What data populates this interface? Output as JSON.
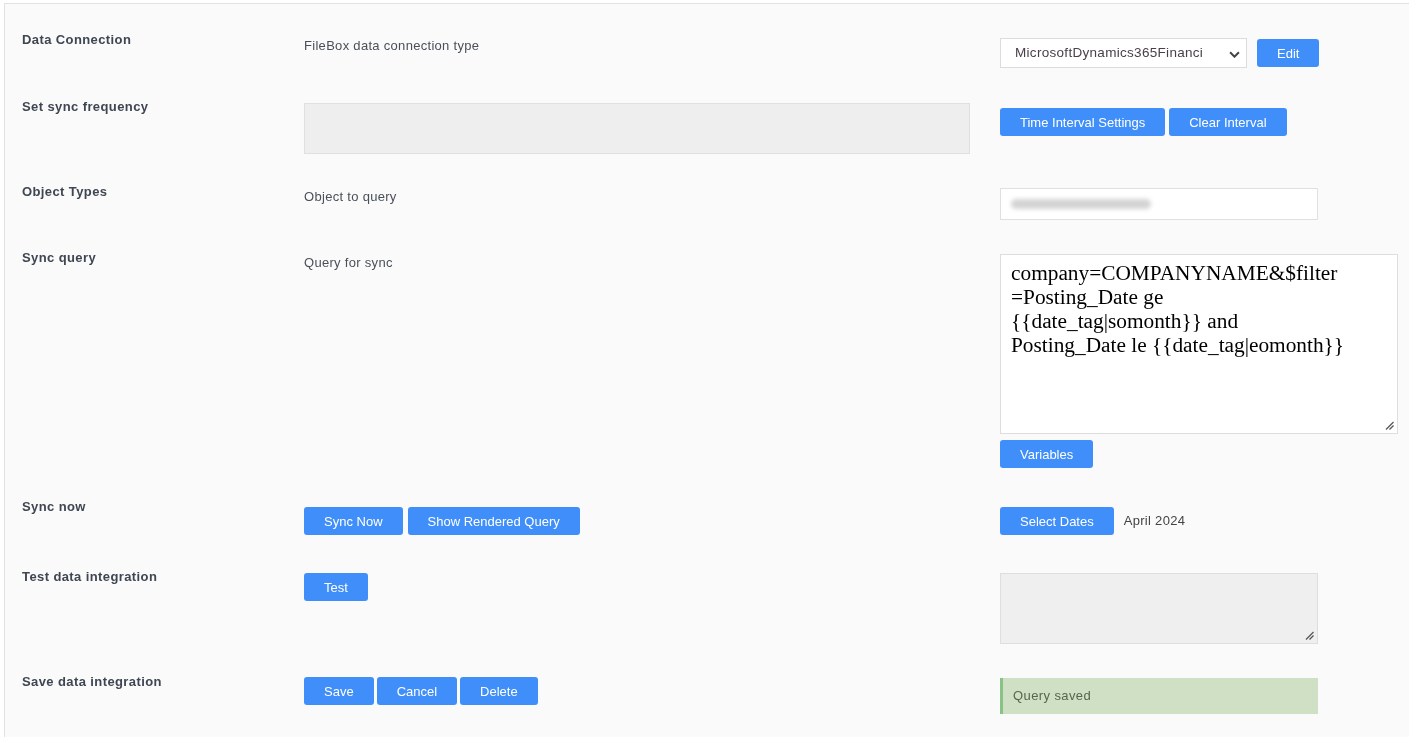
{
  "rows": [
    {
      "label": "Data Connection",
      "middle": [
        {
          "kind": "text",
          "text": "FileBox data connection type"
        }
      ],
      "right": [
        {
          "kind": "select",
          "value": "MicrosoftDynamics365Financi"
        },
        {
          "kind": "button",
          "label": "Edit"
        }
      ]
    },
    {
      "label": "Set sync frequency",
      "middle": [
        {
          "kind": "input",
          "disabled": true
        }
      ],
      "right": [
        {
          "kind": "button",
          "label": "Time Interval Settings"
        },
        {
          "kind": "button",
          "label": "Clear Interval"
        }
      ]
    },
    {
      "label": "Object Types",
      "middle": [
        {
          "kind": "text",
          "text": "Object to query"
        }
      ],
      "right": [
        {
          "kind": "input",
          "disabled": false,
          "blurred": true
        }
      ]
    },
    {
      "label": "Sync query",
      "middle": [
        {
          "kind": "text",
          "text": "Query for sync"
        }
      ],
      "right": [
        {
          "kind": "textarea",
          "disabled": false,
          "value": "company=COMPANYNAME&$filter=Posting_Date ge {{date_tag|somonth}} and Posting_Date le {{date_tag|eomonth}}"
        },
        {
          "kind": "button",
          "label": "Variables"
        }
      ]
    },
    {
      "label": "Sync now",
      "middle": [
        {
          "kind": "button",
          "label": "Sync Now"
        },
        {
          "kind": "button",
          "label": "Show Rendered Query"
        }
      ],
      "right": [
        {
          "kind": "button",
          "label": "Select Dates"
        },
        {
          "kind": "text",
          "text": "April 2024"
        }
      ]
    },
    {
      "label": "Test data integration",
      "middle": [
        {
          "kind": "button",
          "label": "Test"
        }
      ],
      "right": [
        {
          "kind": "textarea",
          "disabled": true
        }
      ]
    },
    {
      "label": "Save data integration",
      "middle": [
        {
          "kind": "button",
          "label": "Save"
        },
        {
          "kind": "button",
          "label": "Cancel"
        },
        {
          "kind": "button",
          "label": "Delete"
        }
      ],
      "right": [
        {
          "kind": "alert",
          "text": "Query saved"
        }
      ]
    }
  ]
}
